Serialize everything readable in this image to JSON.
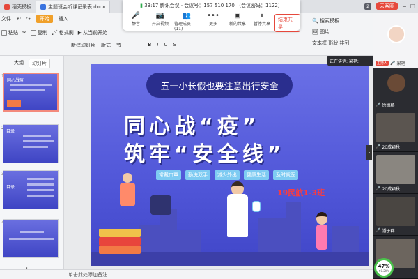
{
  "titlebar": {
    "tabs": [
      {
        "label": "稻壳模板",
        "color": "#e6483c"
      },
      {
        "label": "主题班会听课记录表.docx",
        "color": "#3b74e0"
      }
    ],
    "badge": "2",
    "user_button": "云客圈"
  },
  "ribbon": {
    "menu": [
      "文件",
      "开始",
      "插入"
    ],
    "active_menu": "开始",
    "tools_row1": [
      "复制",
      "格式刷"
    ],
    "paste_label": "粘贴",
    "from_current": "从当前开始",
    "new_slide": "新建幻灯片",
    "layout": "版式",
    "section": "节",
    "search": "搜索模板",
    "pic": "图片",
    "textbox": "文本框",
    "shape": "形状",
    "arrange": "排列",
    "font_format": [
      "B",
      "I",
      "U",
      "S"
    ]
  },
  "meeting": {
    "time": "33:17",
    "info": "腾讯会议 · 会议号：157 510 170 （会议密码：1122）",
    "tools": [
      {
        "icon": "microphone-icon",
        "glyph": "🎤",
        "label": "静音"
      },
      {
        "icon": "camera-icon",
        "glyph": "📷",
        "label": "开启视频"
      },
      {
        "icon": "members-icon",
        "glyph": "👥",
        "label": "管理成员(11)"
      },
      {
        "icon": "more-icon",
        "glyph": "•••",
        "label": "更多"
      },
      {
        "icon": "new-share-icon",
        "glyph": "▣",
        "label": "新的共享"
      },
      {
        "icon": "pause-share-icon",
        "glyph": "⏸",
        "label": "暂停共享"
      }
    ],
    "end_label": "结束共享"
  },
  "left_pane": {
    "tabs": [
      "大纲",
      "幻灯片"
    ],
    "active_tab": "幻灯片",
    "thumbs": [
      {
        "num": "1",
        "title": "同心战疫"
      },
      {
        "num": "2",
        "title": "目录"
      },
      {
        "num": "3",
        "title": "目录"
      },
      {
        "num": "4",
        "title": ""
      }
    ],
    "add": "+"
  },
  "slide": {
    "banner": "五一小长假也要注意出行安全",
    "line1": "同心战“疫”",
    "line2": "筑牢“安全线”",
    "tags": [
      "常戴口罩",
      "勤洗双手",
      "减少外出",
      "健康生活",
      "及时就医"
    ],
    "class_label": "19民航1-3班"
  },
  "statusbar": {
    "note": "单击此处添加备注"
  },
  "speaker_label": "正在讲话: 梁艳;",
  "participants": [
    {
      "name": "梁艳",
      "host": true,
      "host_label": "主持人"
    },
    {
      "name": "徐德鹏",
      "host": false
    },
    {
      "name": "20成颖秋",
      "host": false
    },
    {
      "name": "20成颖秋",
      "host": false
    },
    {
      "name": "潘子群",
      "host": false
    },
    {
      "name": "",
      "host": false
    }
  ],
  "cpu": {
    "value": "47%",
    "sub": "↑0.2K/s"
  }
}
